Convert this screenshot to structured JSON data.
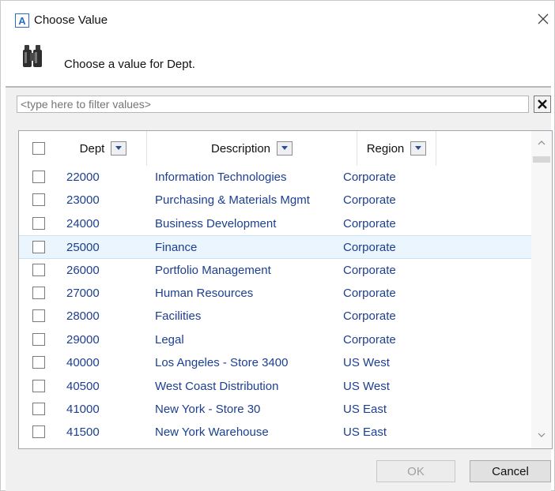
{
  "window": {
    "title": "Choose Value",
    "app_icon_letter": "A"
  },
  "header": {
    "prompt": "Choose a value for Dept."
  },
  "filter": {
    "placeholder": "<type here to filter values>",
    "value": ""
  },
  "grid": {
    "columns": [
      {
        "key": "dept",
        "label": "Dept"
      },
      {
        "key": "description",
        "label": "Description"
      },
      {
        "key": "region",
        "label": "Region"
      }
    ],
    "rows": [
      {
        "dept": "22000",
        "description": "Information Technologies",
        "region": "Corporate",
        "checked": false
      },
      {
        "dept": "23000",
        "description": "Purchasing & Materials Mgmt",
        "region": "Corporate",
        "checked": false
      },
      {
        "dept": "24000",
        "description": "Business Development",
        "region": "Corporate",
        "checked": false
      },
      {
        "dept": "25000",
        "description": "Finance",
        "region": "Corporate",
        "checked": false,
        "highlighted": true
      },
      {
        "dept": "26000",
        "description": "Portfolio Management",
        "region": "Corporate",
        "checked": false
      },
      {
        "dept": "27000",
        "description": "Human Resources",
        "region": "Corporate",
        "checked": false
      },
      {
        "dept": "28000",
        "description": "Facilities",
        "region": "Corporate",
        "checked": false
      },
      {
        "dept": "29000",
        "description": "Legal",
        "region": "Corporate",
        "checked": false
      },
      {
        "dept": "40000",
        "description": "Los Angeles - Store 3400",
        "region": "US West",
        "checked": false
      },
      {
        "dept": "40500",
        "description": "West Coast Distribution",
        "region": "US West",
        "checked": false
      },
      {
        "dept": "41000",
        "description": "New York - Store 30",
        "region": "US East",
        "checked": false
      },
      {
        "dept": "41500",
        "description": "New York Warehouse",
        "region": "US East",
        "checked": false
      }
    ]
  },
  "buttons": {
    "ok": "OK",
    "cancel": "Cancel"
  },
  "icons": {
    "app": "app-logo-icon",
    "close": "close-icon",
    "header": "binoculars-icon",
    "filter_clear": "clear-filter-icon",
    "column_dropdown": "chevron-down-icon",
    "scroll_up": "chevron-up-icon",
    "scroll_down": "chevron-down-icon"
  },
  "colors": {
    "row_text": "#1c3f8f",
    "row_highlight": "#eaf5fd",
    "grid_border": "#9fa6ad",
    "app_icon": "#2b6cc4"
  }
}
